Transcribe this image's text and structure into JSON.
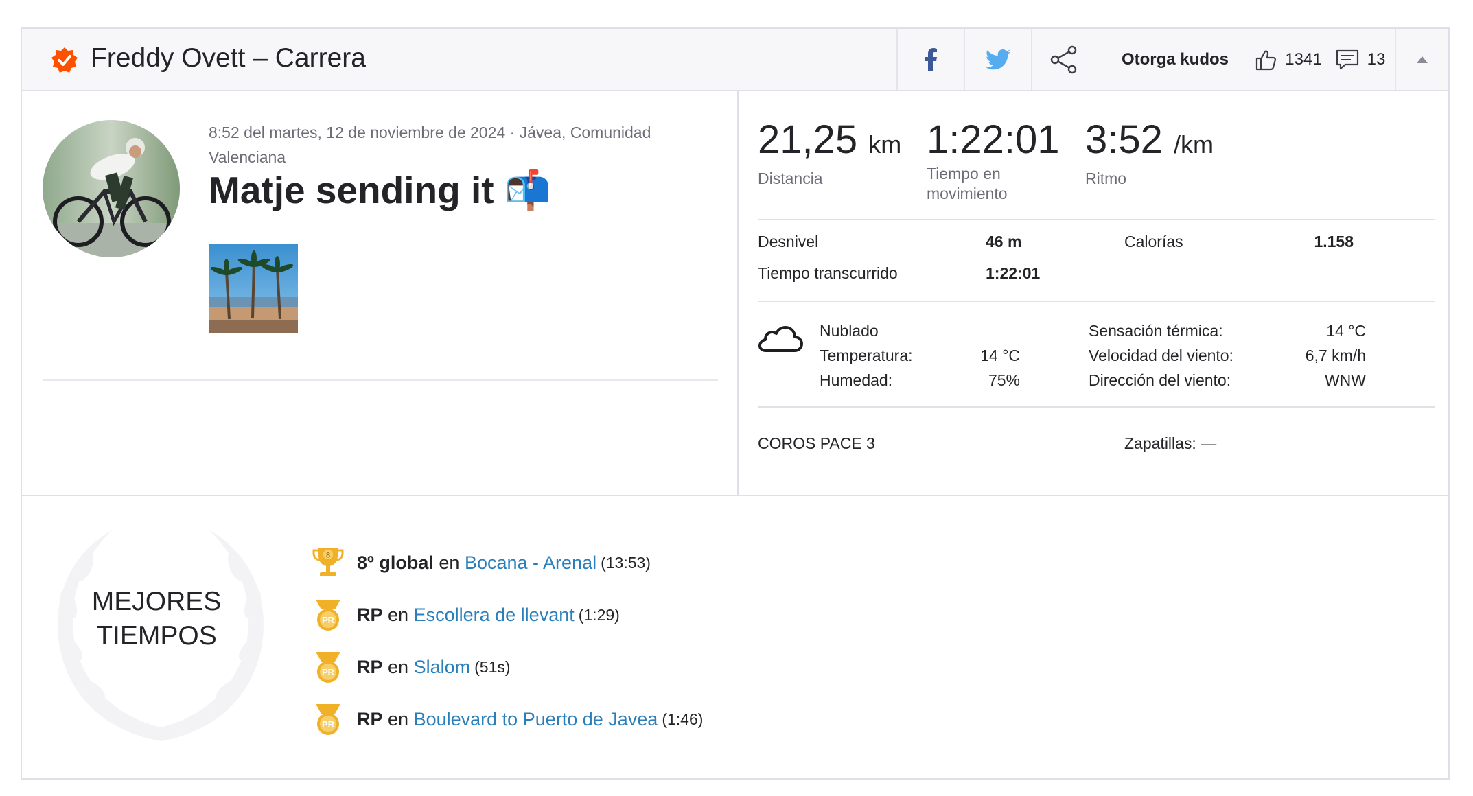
{
  "header": {
    "title": "Freddy Ovett – Carrera",
    "give_kudos_label": "Otorga kudos",
    "kudos_count": "1341",
    "comment_count": "13"
  },
  "activity": {
    "meta": "8:52 del martes, 12 de noviembre de 2024 · Jávea, Comunidad Valenciana",
    "title": "Matje sending it 📬"
  },
  "stats": {
    "distance_value": "21,25",
    "distance_unit": "km",
    "distance_label": "Distancia",
    "moving_time_value": "1:22:01",
    "moving_time_label": "Tiempo en movimiento",
    "pace_value": "3:52",
    "pace_unit": "/km",
    "pace_label": "Ritmo"
  },
  "details": {
    "elevation_label": "Desnivel",
    "elevation_value": "46 m",
    "calories_label": "Calorías",
    "calories_value": "1.158",
    "elapsed_label": "Tiempo transcurrido",
    "elapsed_value": "1:22:01"
  },
  "weather": {
    "condition": "Nublado",
    "temperature_label": "Temperatura:",
    "temperature_value": "14 °C",
    "humidity_label": "Humedad:",
    "humidity_value": "75%",
    "feels_like_label": "Sensación térmica:",
    "feels_like_value": "14 °C",
    "wind_speed_label": "Velocidad del viento:",
    "wind_speed_value": "6,7 km/h",
    "wind_dir_label": "Dirección del viento:",
    "wind_dir_value": "WNW"
  },
  "gear": {
    "device": "COROS PACE 3",
    "shoes": "Zapatillas: —"
  },
  "best_efforts": {
    "label_line1": "MEJORES",
    "label_line2": "TIEMPOS",
    "connector": "en",
    "items": [
      {
        "rank": "8º global",
        "segment": "Bocana - Arenal",
        "time": "(13:53)",
        "icon": "trophy-icon",
        "icon_text": "8"
      },
      {
        "rank": "RP",
        "segment": "Escollera de llevant",
        "time": "(1:29)",
        "icon": "pr-medal-icon",
        "icon_text": "PR"
      },
      {
        "rank": "RP",
        "segment": "Slalom",
        "time": "(51s)",
        "icon": "pr-medal-icon",
        "icon_text": "PR"
      },
      {
        "rank": "RP",
        "segment": "Boulevard to Puerto de Javea",
        "time": "(1:46)",
        "icon": "pr-medal-icon",
        "icon_text": "PR"
      }
    ]
  },
  "colors": {
    "brand_orange": "#fc5200",
    "link_blue": "#2a7fba",
    "facebook_blue": "#3b5998",
    "twitter_blue": "#55acee",
    "medal_gold": "#f0b129"
  }
}
